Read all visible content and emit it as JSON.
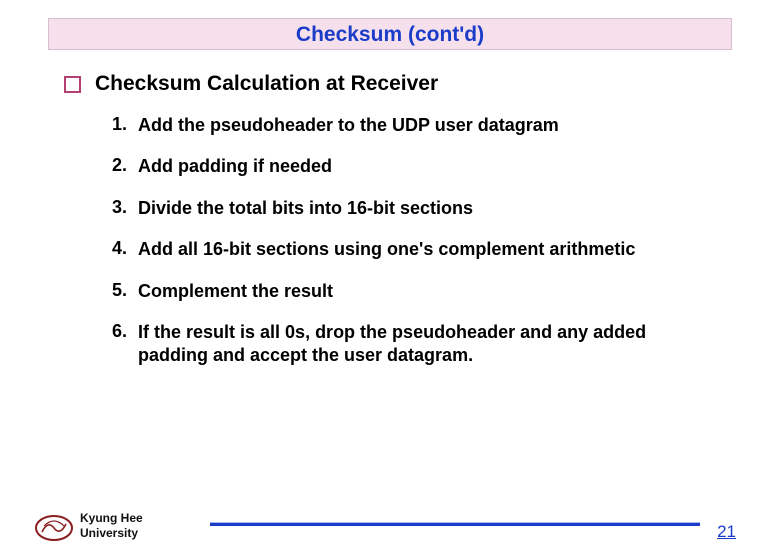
{
  "title": "Checksum (cont'd)",
  "section_heading": "Checksum Calculation at Receiver",
  "items": [
    {
      "num": "1.",
      "text": "Add the pseudoheader to the UDP user datagram"
    },
    {
      "num": "2.",
      "text": " Add padding if needed"
    },
    {
      "num": "3.",
      "text": " Divide the total bits into 16-bit sections"
    },
    {
      "num": "4.",
      "text": " Add all 16-bit sections using one's complement arithmetic"
    },
    {
      "num": "5.",
      "text": " Complement the result"
    },
    {
      "num": "6.",
      "text": " If the result is all 0s, drop the pseudoheader and any added padding and accept the user datagram."
    }
  ],
  "footer": {
    "university_line1": "Kyung Hee",
    "university_line2": "University",
    "page_number": "21"
  },
  "colors": {
    "title_bg": "#f6e0ec",
    "title_fg": "#1a3cc9",
    "bullet_border": "#b43f73",
    "rule": "#1a3cc9"
  }
}
